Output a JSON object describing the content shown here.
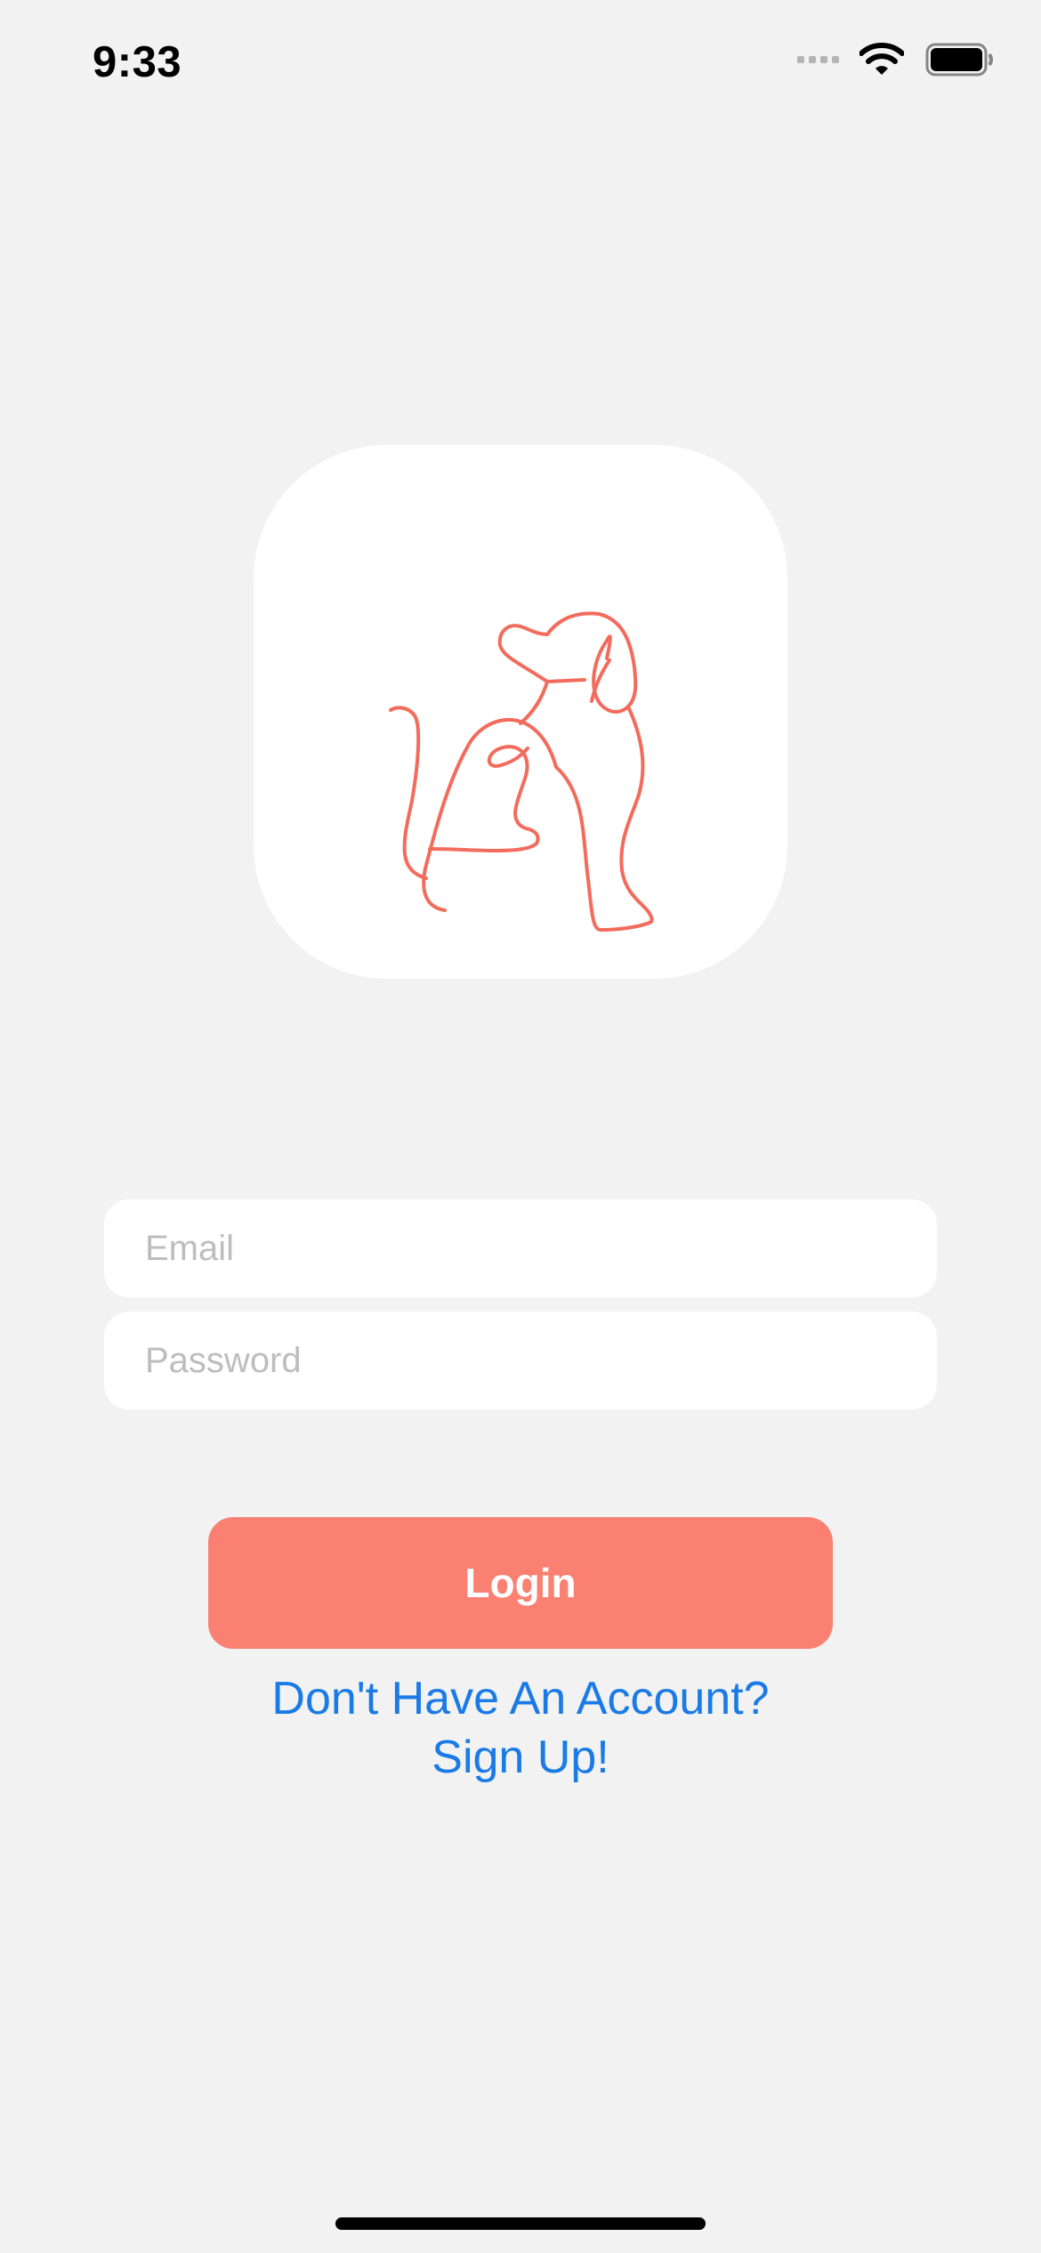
{
  "status_bar": {
    "time": "9:33",
    "icons": [
      "signal-icon",
      "wifi-icon",
      "battery-icon"
    ]
  },
  "logo": {
    "icon": "dog-line-art-icon",
    "stroke_color": "#f36b5c",
    "tile_color": "#ffffff"
  },
  "form": {
    "email_placeholder": "Email",
    "email_value": "",
    "password_placeholder": "Password",
    "password_value": ""
  },
  "login_button": {
    "label": "Login",
    "color": "#fa8072"
  },
  "signup": {
    "line1": "Don't Have An Account?",
    "line2": "Sign Up!",
    "color": "#1a7ae6"
  },
  "colors": {
    "background": "#f2f2f2"
  }
}
